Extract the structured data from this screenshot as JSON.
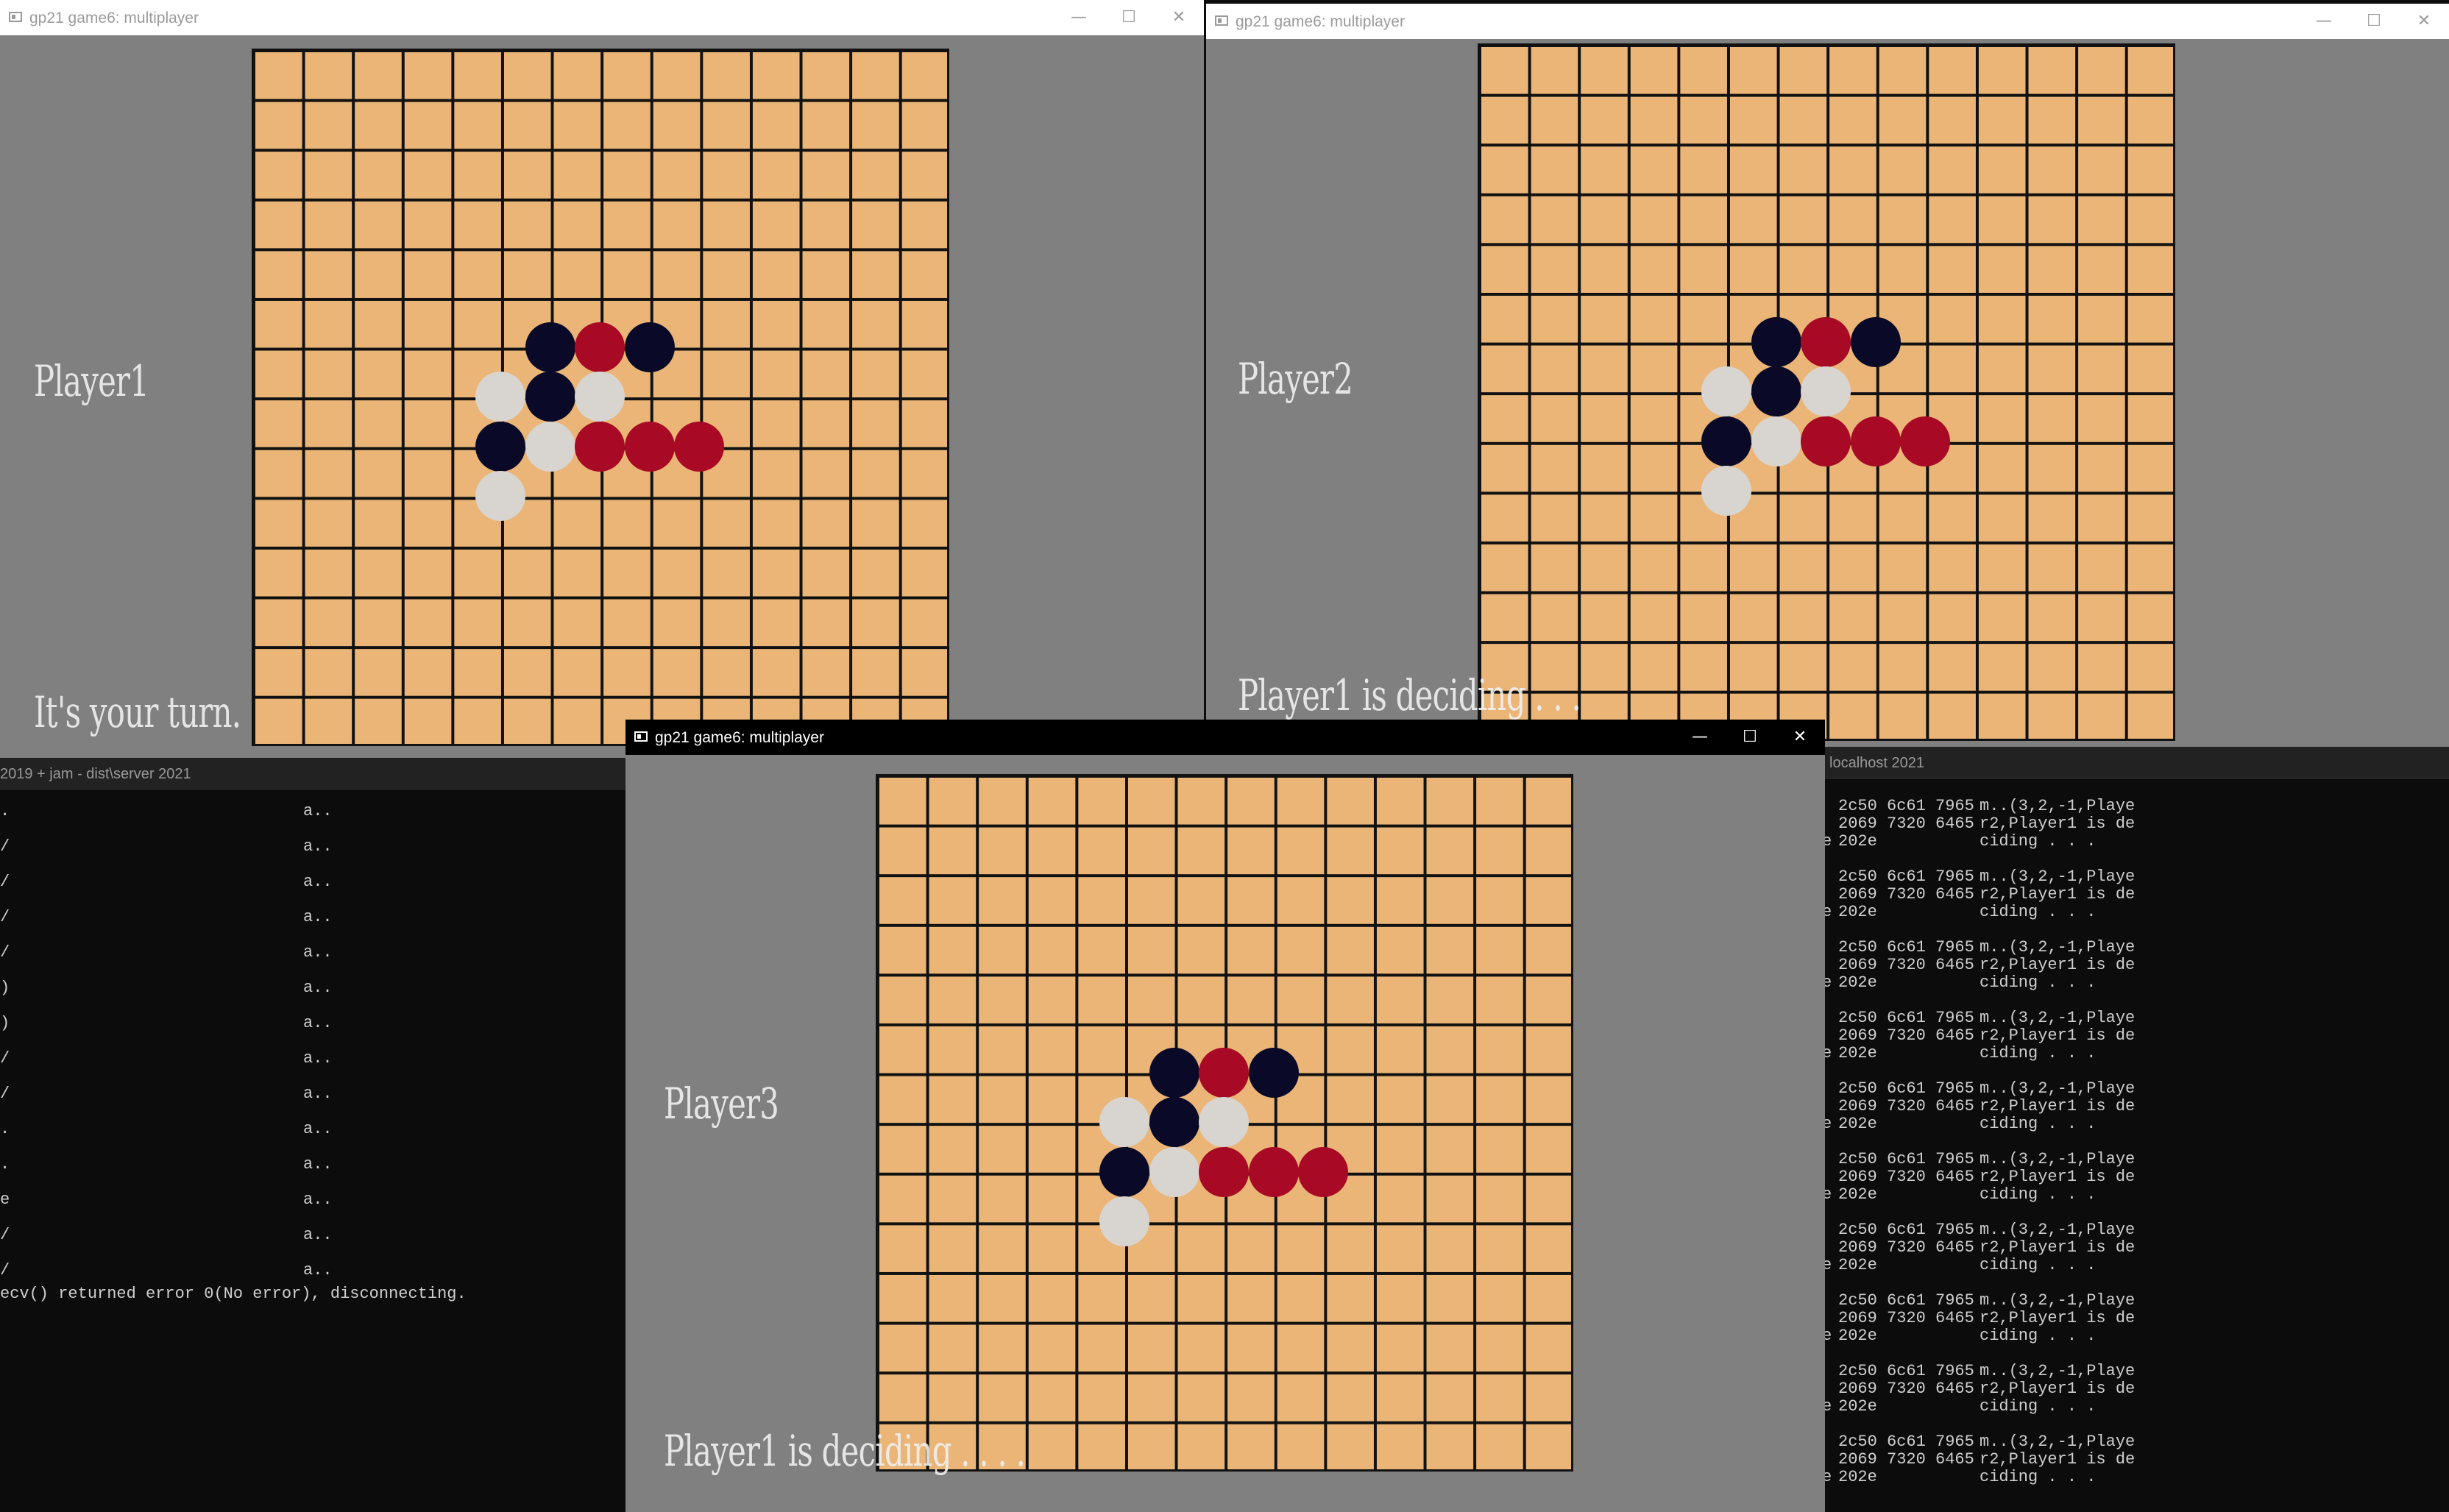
{
  "colors": {
    "board": "#eab577",
    "grid": "#111111",
    "black_stone": "#0a0a28",
    "red_stone": "#a80a25",
    "white_stone": "#d8d5d0"
  },
  "windows": {
    "w1": {
      "title": "gp21 game6: multiplayer",
      "player": "Player1",
      "status": "It's your turn."
    },
    "w2": {
      "title": "gp21 game6: multiplayer",
      "player": "Player2",
      "status": "Player1 is deciding . . ."
    },
    "w3": {
      "title": "gp21 game6: multiplayer",
      "player": "Player3",
      "status": "Player1 is deciding . . . ."
    }
  },
  "controls": {
    "minimize": "—",
    "maximize": "☐",
    "close": "✕"
  },
  "board": {
    "size": 14,
    "stones": [
      {
        "col": 6,
        "row": 6,
        "color": "black"
      },
      {
        "col": 7,
        "row": 6,
        "color": "red"
      },
      {
        "col": 8,
        "row": 6,
        "color": "black"
      },
      {
        "col": 5,
        "row": 7,
        "color": "white"
      },
      {
        "col": 6,
        "row": 7,
        "color": "black"
      },
      {
        "col": 7,
        "row": 7,
        "color": "white"
      },
      {
        "col": 5,
        "row": 8,
        "color": "black"
      },
      {
        "col": 6,
        "row": 8,
        "color": "white"
      },
      {
        "col": 7,
        "row": 8,
        "color": "red"
      },
      {
        "col": 8,
        "row": 8,
        "color": "red"
      },
      {
        "col": 9,
        "row": 8,
        "color": "red"
      },
      {
        "col": 5,
        "row": 9,
        "color": "white"
      }
    ]
  },
  "server_console": {
    "title": "2019 + jam - dist\\server  2021",
    "left_marks": [
      ".",
      "/",
      "/",
      "/",
      "/",
      ")",
      ")",
      "/",
      "/",
      ".",
      ".",
      "e",
      "/",
      "/"
    ],
    "middle_text": "a..",
    "error_line": "ecv() returned error 0(No error), disconnecting."
  },
  "client_console": {
    "title": "localhost 2021",
    "entry_hex": [
      "2c50 6c61 7965",
      "2069 7320 6465",
      "202e"
    ],
    "entry_ascii": [
      "m..(3,2,-1,Playe",
      "r2,Player1 is de",
      "ciding . . ."
    ],
    "left_marks": [
      "e",
      "e",
      "e",
      "e",
      "e",
      "e",
      "e",
      "e",
      "e",
      "e"
    ]
  }
}
